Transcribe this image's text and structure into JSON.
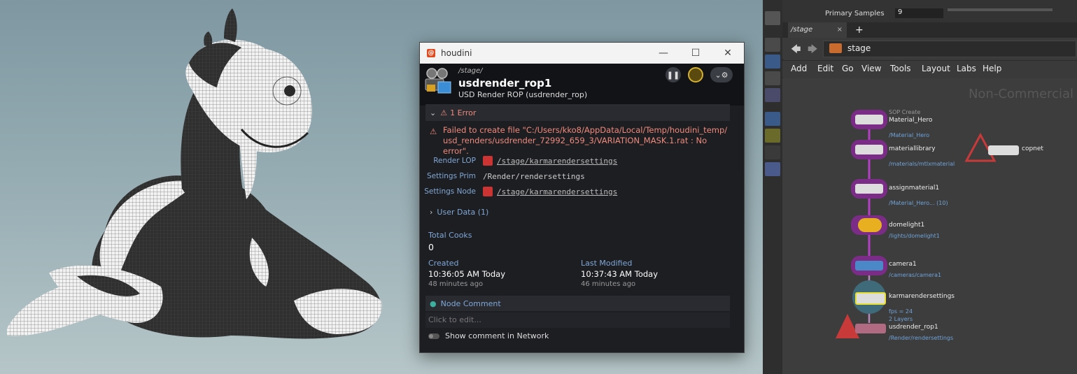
{
  "dialog": {
    "window_title": "houdini",
    "node_path": "/stage/",
    "node_name": "usdrender_rop1",
    "node_type": "USD Render ROP  (usdrender_rop)",
    "error_header": "1 Error",
    "error_line1": "Failed to create file \"C:/Users/kko8/AppData/Local/Temp/houdini_temp/",
    "error_line2": "usd_renders/usdrender_72992_659_3/VARIATION_MASK.1.rat : No error\".",
    "params": {
      "render_lop_label": "Render LOP",
      "render_lop_value": "/stage/karmarendersettings",
      "settings_prim_label": "Settings Prim",
      "settings_prim_value": "/Render/rendersettings",
      "settings_node_label": "Settings Node",
      "settings_node_value": "/stage/karmarendersettings"
    },
    "user_data": "User Data (1)",
    "total_cooks_label": "Total Cooks",
    "total_cooks_value": "0",
    "created_label": "Created",
    "created_value": "10:36:05 AM Today",
    "created_ago": "48 minutes ago",
    "modified_label": "Last Modified",
    "modified_value": "10:37:43 AM Today",
    "modified_ago": "46 minutes ago",
    "node_comment_label": "Node Comment",
    "comment_placeholder": "Click to edit...",
    "show_comment_label": "Show comment in Network"
  },
  "network": {
    "top_param_label": "Primary Samples",
    "top_param_value": "9",
    "tab_label": "/stage",
    "path": "stage",
    "menu": [
      "Add",
      "Edit",
      "Go",
      "View",
      "Tools",
      "Layout",
      "Labs",
      "Help"
    ],
    "watermark": "Non-Commercial",
    "nodes": {
      "material_hero": {
        "pre": "SOP Create",
        "name": "Material_Hero",
        "path": "/Material_Hero"
      },
      "materiallibrary": {
        "name": "materiallibrary",
        "path": "/materials/mtlxmaterial"
      },
      "assignmaterial": {
        "name": "assignmaterial1",
        "path": "/Material_Hero... (10)"
      },
      "domelight": {
        "name": "domelight1",
        "path": "/lights/domelight1"
      },
      "camera": {
        "name": "camera1",
        "path": "/cameras/camera1"
      },
      "karma": {
        "name": "karmarendersettings",
        "fps": "fps = 24",
        "layers": "2 Layers"
      },
      "usdrender": {
        "name": "usdrender_rop1",
        "path": "/Render/rendersettings"
      },
      "copnet": {
        "name": "copnet"
      }
    }
  },
  "colors": {
    "error": "#f08a7c",
    "link": "#7fa7d6",
    "wire": "#b33fc4"
  }
}
